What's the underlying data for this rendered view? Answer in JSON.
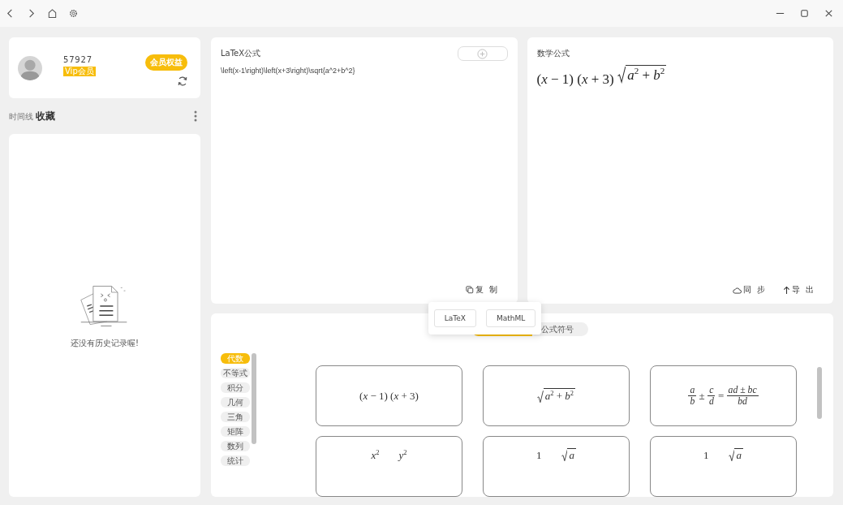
{
  "profile": {
    "user_id": "57927",
    "badge": "Vip会员",
    "benefits_button": "会员权益"
  },
  "history_tabs": [
    {
      "label": "时间线",
      "selected": false
    },
    {
      "label": "收藏",
      "selected": true
    }
  ],
  "history": {
    "empty_text": "还没有历史记录喔!"
  },
  "latex_panel": {
    "title": "LaTeX公式",
    "source": "\\left(x-1\\right)\\left(x+3\\right)\\sqrt{a^2+b^2}",
    "copy_button": "复 制"
  },
  "copy_menu": {
    "options": [
      "LaTeX",
      "MathML"
    ]
  },
  "math_panel": {
    "title": "数学公式",
    "rendered": [
      {
        "kind": "text",
        "text": "(*x* − 1) (*x* + 3) "
      },
      {
        "kind": "sqrt",
        "text": "*a*$^{2}$ + *b*$^{2}$"
      }
    ],
    "sync_button": "同 步",
    "export_button": "导 出"
  },
  "library": {
    "tabs": [
      {
        "selected": true
      },
      {
        "label": "公式符号",
        "selected": false
      }
    ],
    "categories": [
      {
        "label": "代数",
        "selected": true
      },
      {
        "label": "不等式",
        "selected": false
      },
      {
        "label": "积分",
        "selected": false
      },
      {
        "label": "几何",
        "selected": false
      },
      {
        "label": "三角",
        "selected": false
      },
      {
        "label": "矩阵",
        "selected": false
      },
      {
        "label": "数列",
        "selected": false
      },
      {
        "label": "统计",
        "selected": false
      }
    ],
    "formulas": [
      {
        "pieces": [
          {
            "kind": "text",
            "text": "(*x* − 1) (*x* + 3)"
          }
        ]
      },
      {
        "pieces": [
          {
            "kind": "sqrt",
            "text": "*a*$^{2}$ + *b*$^{2}$"
          }
        ]
      },
      {
        "pieces": [
          {
            "kind": "frac",
            "num": "*a*",
            "den": "*b*"
          },
          {
            "kind": "text",
            "text": " ± "
          },
          {
            "kind": "frac",
            "num": "*c*",
            "den": "*d*"
          },
          {
            "kind": "text",
            "text": " = "
          },
          {
            "kind": "frac",
            "num": "*ad* ± *bc*",
            "den": "*bd*"
          }
        ]
      },
      {
        "pieces": [
          {
            "kind": "text",
            "text": "*x*$^{2}$"
          },
          {
            "kind": "text",
            "text": "*y*$^{2}$"
          }
        ]
      },
      {
        "pieces": [
          {
            "kind": "text",
            "text": "1"
          },
          {
            "kind": "sqrt",
            "text": "*a*"
          }
        ]
      },
      {
        "pieces": [
          {
            "kind": "text",
            "text": "1"
          },
          {
            "kind": "sqrt",
            "text": "*a*"
          }
        ]
      }
    ]
  }
}
